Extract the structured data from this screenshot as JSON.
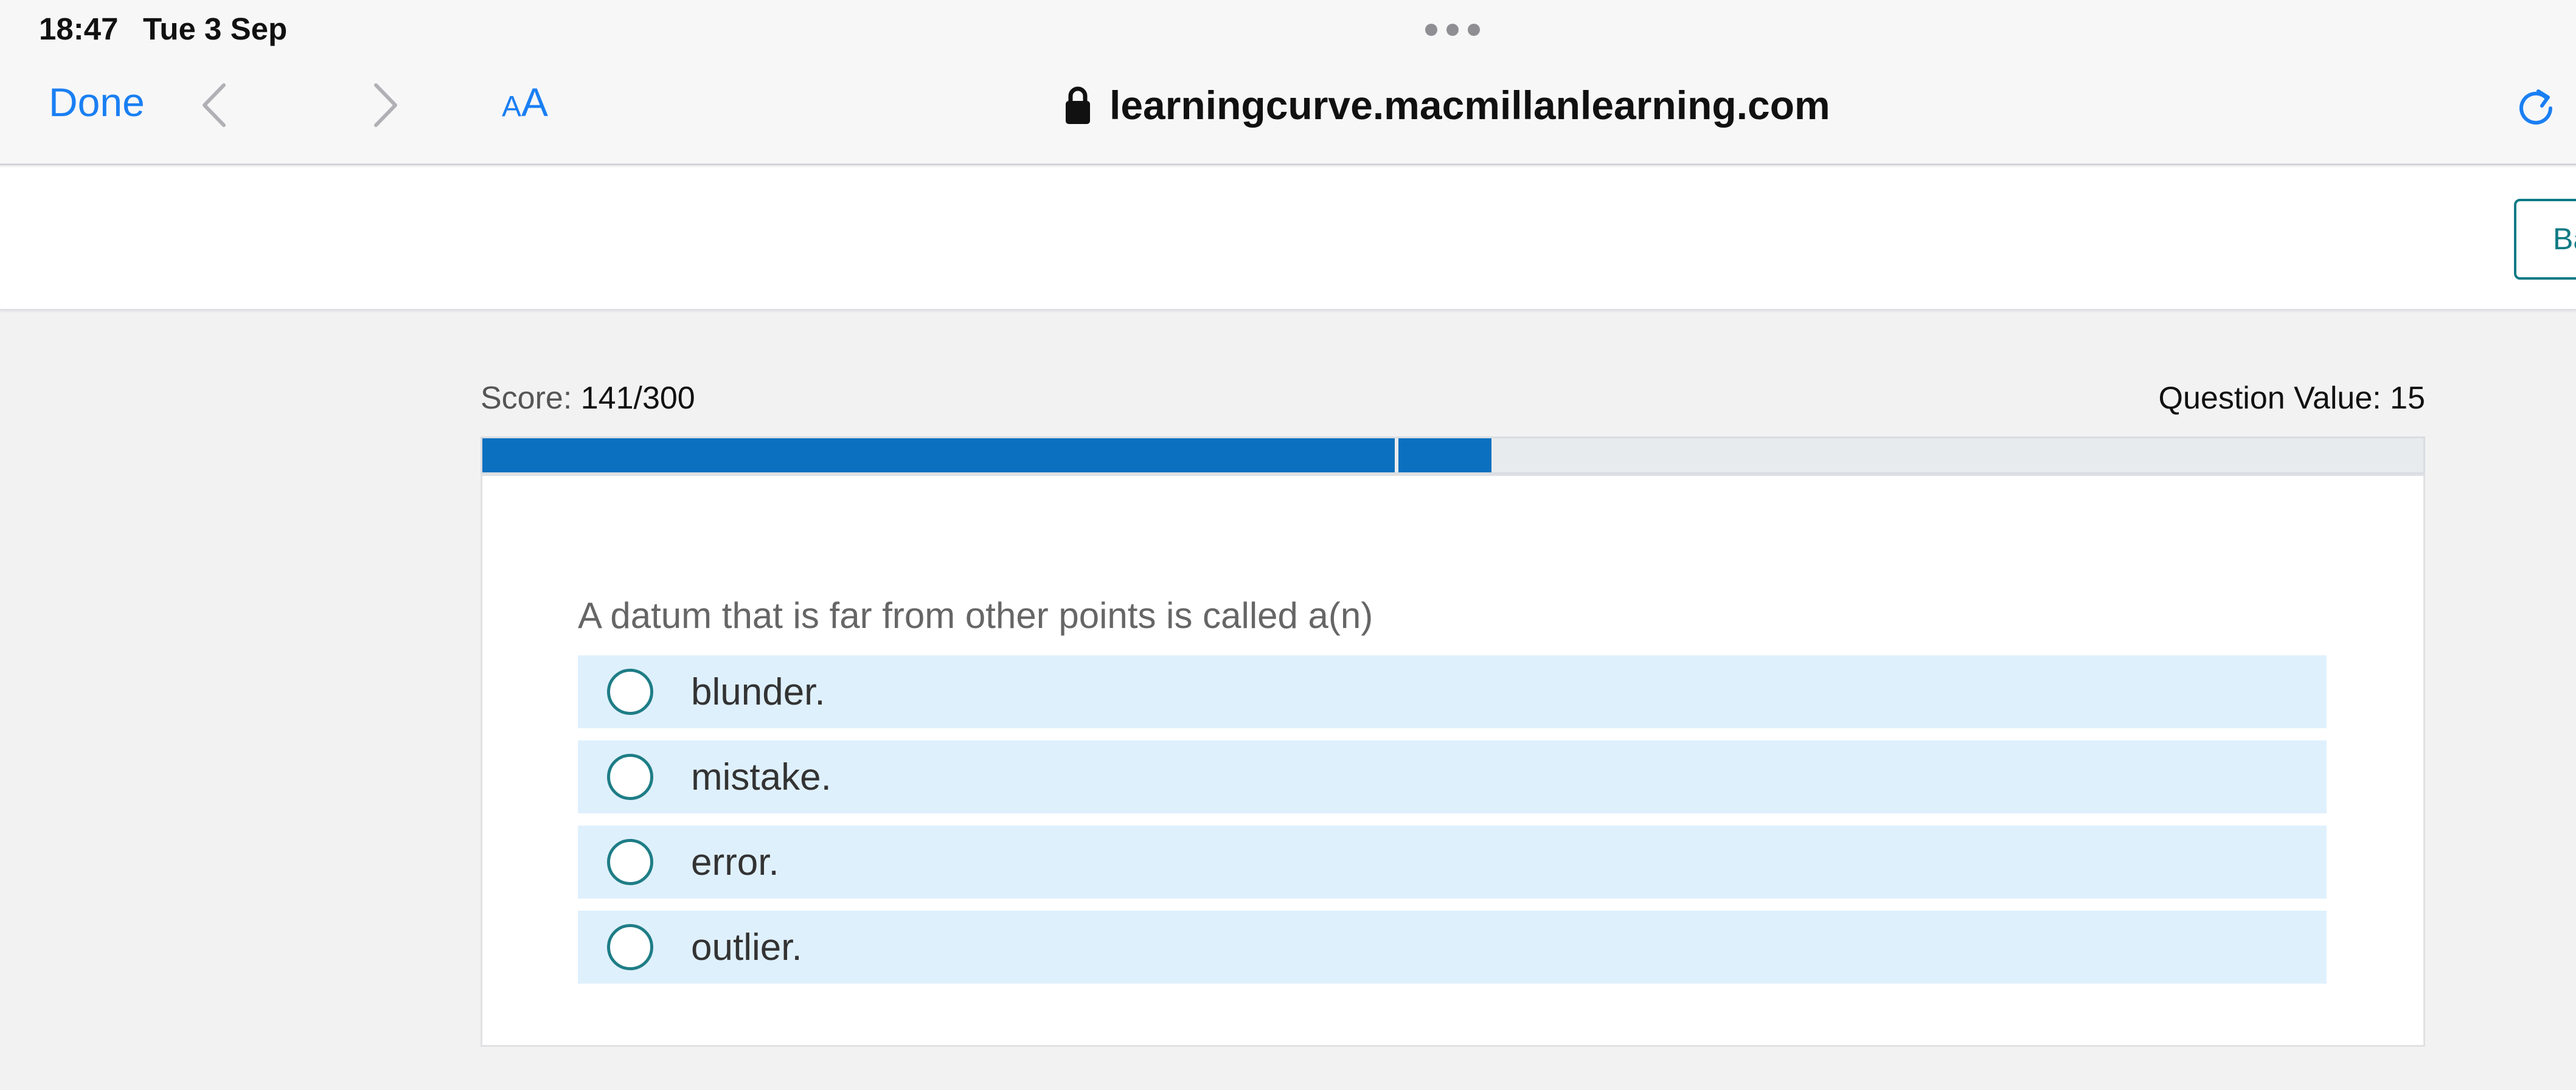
{
  "status_bar": {
    "time": "18:47",
    "date": "Tue 3 Sep"
  },
  "browser": {
    "done_label": "Done",
    "aa_small": "A",
    "aa_large": "A",
    "url": "learningcurve.macmillanlearning.com",
    "icons": [
      "chevron-left-icon",
      "chevron-right-icon",
      "lock-icon",
      "reload-icon"
    ]
  },
  "header": {
    "button_label": "Ba"
  },
  "quiz": {
    "score_label": "Score: ",
    "score_value": "141/300",
    "question_value": "Question Value: 15",
    "progress": {
      "completed_fraction": 0.47,
      "pending_fraction": 0.05
    },
    "question": "A datum that is far from other points is called a(n)",
    "options": [
      {
        "label": "blunder."
      },
      {
        "label": "mistake."
      },
      {
        "label": "error."
      },
      {
        "label": "outlier."
      }
    ]
  },
  "colors": {
    "accent_blue": "#1a7ff3",
    "progress_blue": "#0a70bf",
    "option_bg": "#dff0fd",
    "radio_teal": "#1e7d86"
  }
}
